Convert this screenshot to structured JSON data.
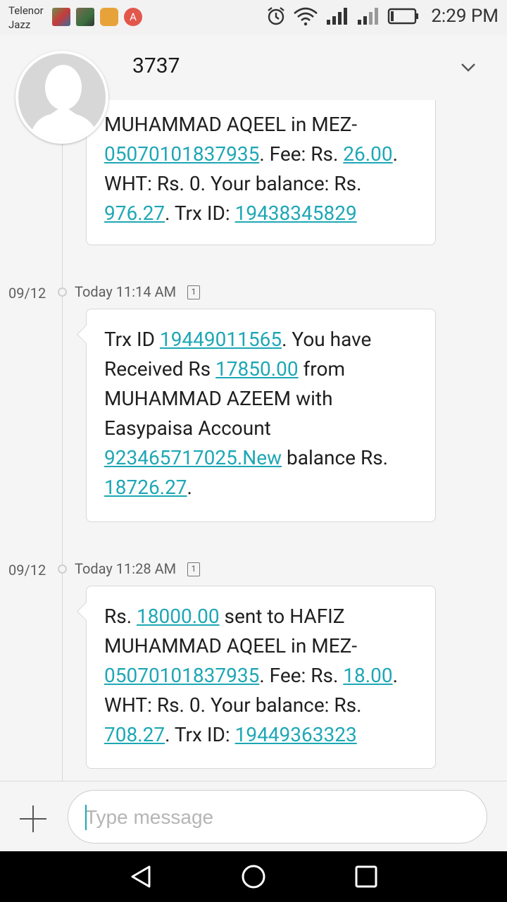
{
  "status_bar": {
    "carrier_line1": "Telenor",
    "carrier_line2": "Jazz",
    "notification_badge": "A",
    "time": "2:29 PM"
  },
  "header": {
    "contact": "3737"
  },
  "messages": [
    {
      "partial": true,
      "segments": [
        {
          "text": "MUHAMMAD AQEEL in MEZ-"
        },
        {
          "text": "05070101837935",
          "link": true
        },
        {
          "text": ". Fee: Rs. "
        },
        {
          "text": "26.00",
          "link": true
        },
        {
          "text": ". WHT: Rs. 0. Your balance: Rs. "
        },
        {
          "text": "976.27",
          "link": true
        },
        {
          "text": ". Trx ID: "
        },
        {
          "text": "19438345829",
          "link": true
        }
      ]
    },
    {
      "date": "09/12",
      "time": "Today 11:14 AM",
      "sim": "1",
      "segments": [
        {
          "text": "Trx ID "
        },
        {
          "text": "19449011565",
          "link": true
        },
        {
          "text": ". You have Received Rs "
        },
        {
          "text": "17850.00",
          "link": true
        },
        {
          "text": " from MUHAMMAD AZEEM with Easypaisa Account "
        },
        {
          "text": "923465717025.New",
          "link": true
        },
        {
          "text": " balance Rs. "
        },
        {
          "text": "18726.27",
          "link": true
        },
        {
          "text": "."
        }
      ]
    },
    {
      "date": "09/12",
      "time": "Today 11:28 AM",
      "sim": "1",
      "segments": [
        {
          "text": "Rs. "
        },
        {
          "text": "18000.00",
          "link": true
        },
        {
          "text": " sent to HAFIZ MUHAMMAD AQEEL in MEZ-"
        },
        {
          "text": "05070101837935",
          "link": true
        },
        {
          "text": ". Fee: Rs. "
        },
        {
          "text": "18.00",
          "link": true
        },
        {
          "text": ". WHT: Rs. 0. Your balance: Rs. "
        },
        {
          "text": "708.27",
          "link": true
        },
        {
          "text": ". Trx ID: "
        },
        {
          "text": "19449363323",
          "link": true
        }
      ]
    }
  ],
  "compose": {
    "placeholder": "Type message"
  },
  "icons": {
    "back": "back-triangle-icon",
    "home": "home-circle-icon",
    "recents": "recents-square-icon",
    "alarm": "alarm-icon",
    "wifi": "wifi-icon",
    "signal": "signal-icon",
    "battery": "battery-icon"
  },
  "colors": {
    "link": "#1ea7b5",
    "bubble": "#ffffff",
    "background": "#f5f5f5"
  }
}
